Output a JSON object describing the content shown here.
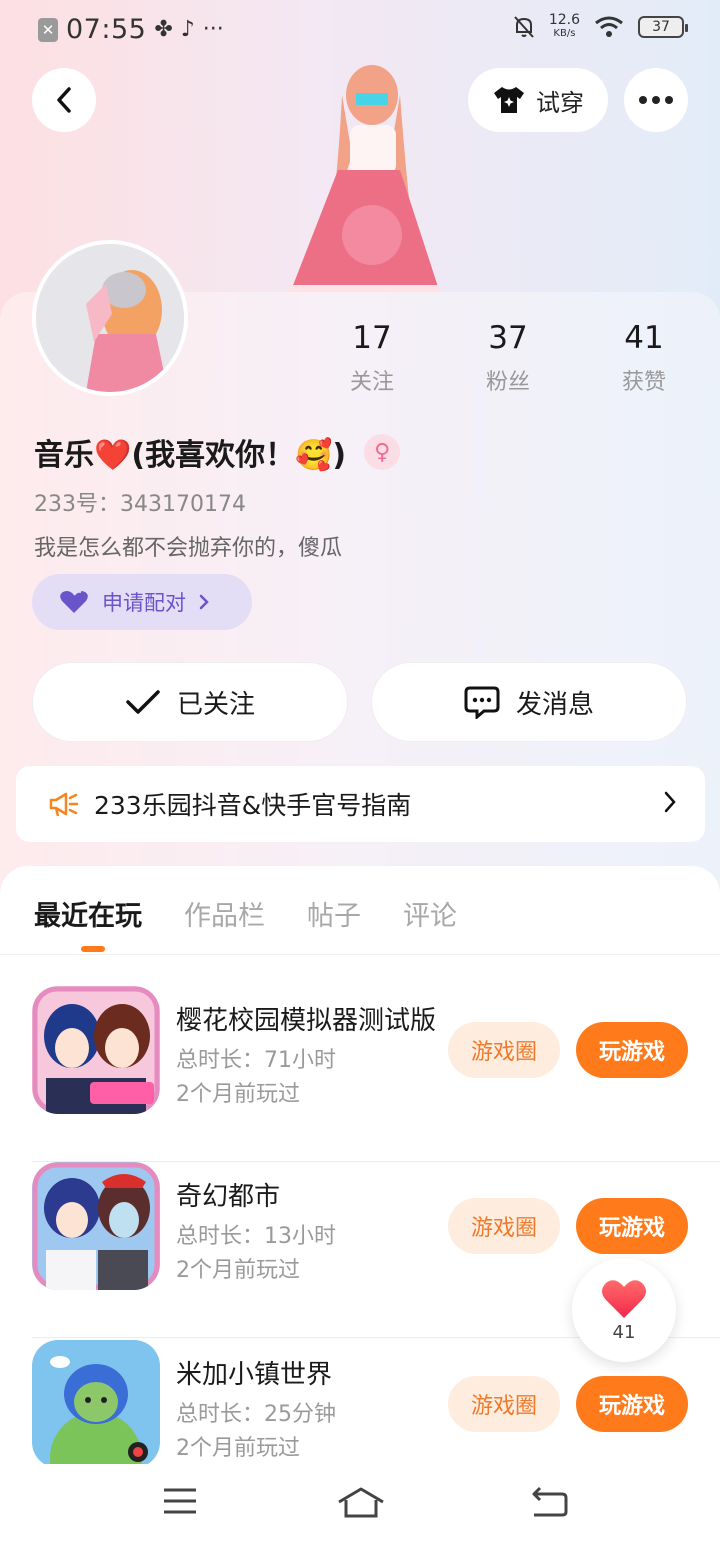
{
  "status_bar": {
    "time": "07:55",
    "net_speed": "12.6",
    "net_unit": "KB/s",
    "battery": "37"
  },
  "header": {
    "tryon_label": "试穿"
  },
  "profile": {
    "stats": [
      {
        "value": "17",
        "label": "关注"
      },
      {
        "value": "37",
        "label": "粉丝"
      },
      {
        "value": "41",
        "label": "获赞"
      }
    ],
    "nickname": "音乐❤️(我喜欢你！🥰)",
    "uid": "233号：343170174",
    "bio": "我是怎么都不会抛弃你的，傻瓜",
    "pair_label": "申请配对",
    "follow_label": "已关注",
    "message_label": "发消息"
  },
  "notice": {
    "text": "233乐园抖音&快手官号指南"
  },
  "tabs": [
    "最近在玩",
    "作品栏",
    "帖子",
    "评论"
  ],
  "games": [
    {
      "name": "樱花校园模拟器测试版",
      "time": "总时长：71小时",
      "last": "2个月前玩过",
      "circle": "游戏圈",
      "play": "玩游戏"
    },
    {
      "name": "奇幻都市",
      "time": "总时长：13小时",
      "last": "2个月前玩过",
      "circle": "游戏圈",
      "play": "玩游戏"
    },
    {
      "name": "米加小镇世界",
      "time": "总时长：25分钟",
      "last": "2个月前玩过",
      "circle": "游戏圈",
      "play": "玩游戏"
    }
  ],
  "like_fab": {
    "count": "41"
  },
  "colors": {
    "accent": "#ff7a1a",
    "accent_light": "#feecde",
    "pair_bg": "#e4ddf6",
    "pair_text": "#6a54c9"
  }
}
